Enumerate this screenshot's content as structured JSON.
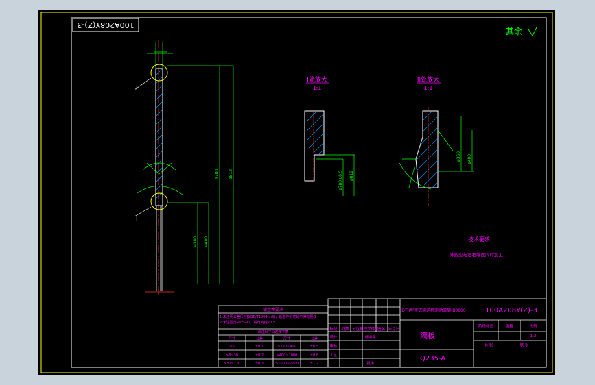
{
  "drawing_code": "100A208Y(Z)-3",
  "drawing_code_rotated": "100A208Y(Z)-3",
  "roughness_note": "其余",
  "views": {
    "detail_1": {
      "title": "I处放大",
      "scale": "1:1"
    },
    "detail_2": {
      "title": "II处放大",
      "scale": "1:1"
    }
  },
  "leaders": {
    "label_1": "I",
    "label_2": "I"
  },
  "tech_req": {
    "title": "技术要求",
    "line1": "外圆应与左右端面同时加工"
  },
  "left_table": {
    "title": "钣金件要求",
    "notes": [
      "1.未注明公差尺寸按GB/T1804-m级，钣金件折弯处不得有裂纹",
      "2.未注圆角R0.5-R1，锐角倒钝R0.5",
      "未注尺寸公差按下表"
    ],
    "headers": [
      "尺寸",
      "公差",
      "尺寸",
      "公差"
    ],
    "rows": [
      [
        "≤6",
        "±0.1",
        ">120~400",
        "±0.5"
      ],
      [
        ">6~30",
        "±0.2",
        ">400~1000",
        "±0.8"
      ],
      [
        ">30~120",
        "±0.3",
        ">1000~2000",
        "±1.2"
      ]
    ]
  },
  "title_block": {
    "project": "DTII型带式输送机驱动滚筒-B0800",
    "code": "100A208Y(Z)-3",
    "part_name": "隔板",
    "material": "Q235-A",
    "rev_headers": [
      "标记",
      "处数",
      "分区",
      "更改文件号",
      "签名",
      "年月日"
    ],
    "role_rows": [
      "设计",
      "审核",
      "工艺"
    ],
    "std": "标准化",
    "approve": "批准",
    "stage": "阶段标记",
    "weight": "重量",
    "scale_label": "比例",
    "scale_value": "1:2",
    "sheet_total": "共 张",
    "sheet_no": "第 张"
  }
}
